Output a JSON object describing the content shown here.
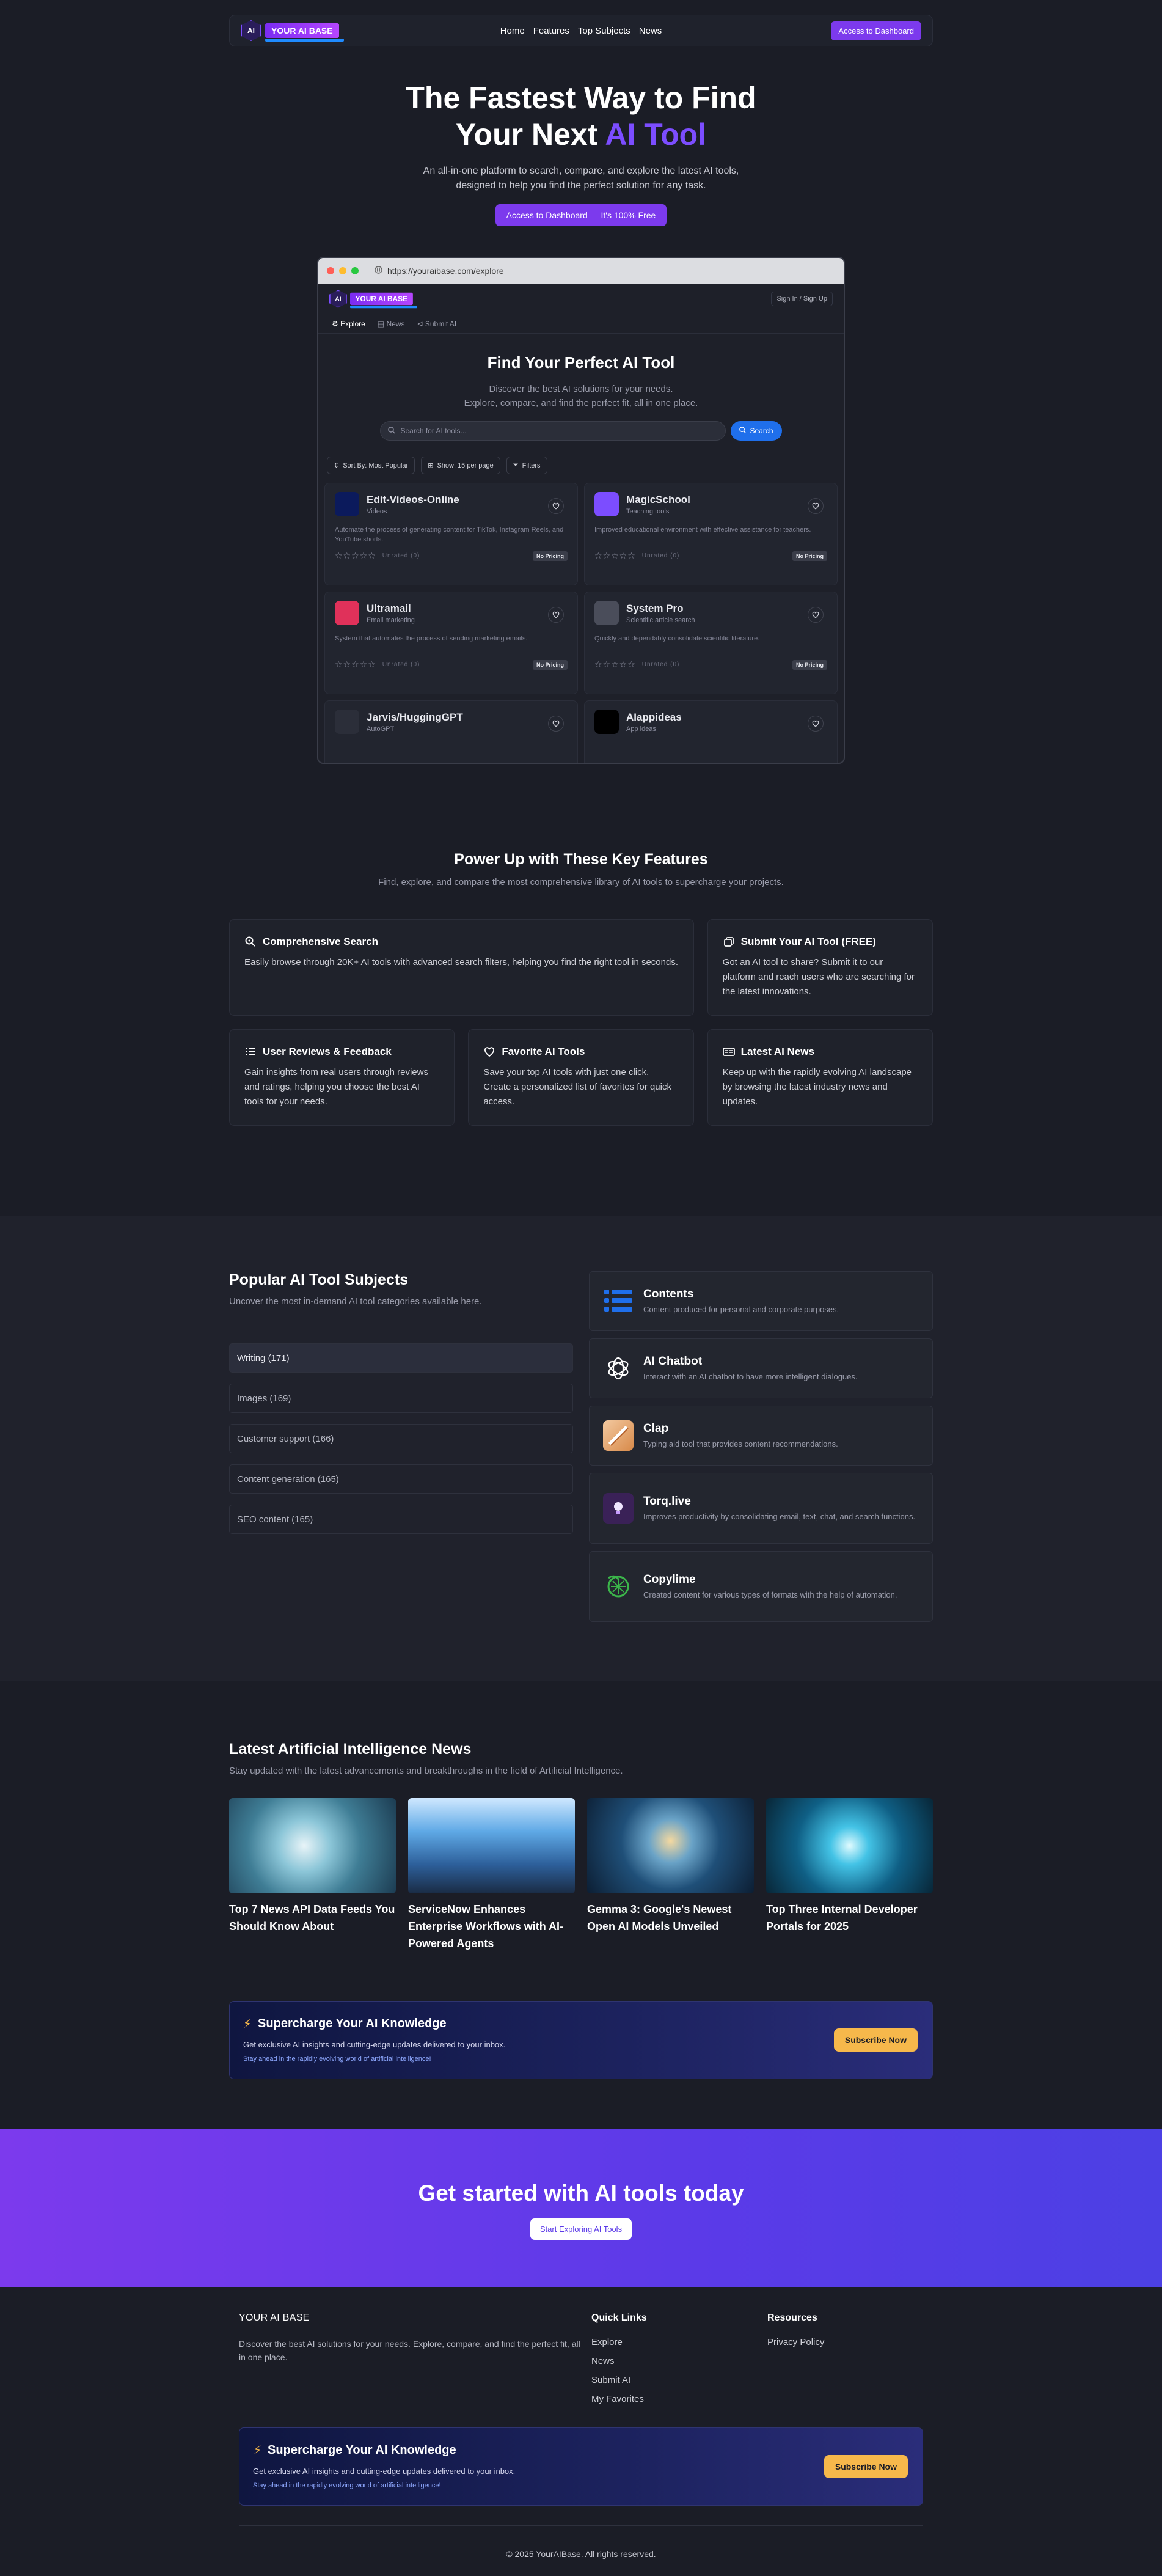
{
  "nav": {
    "logo_mark": "AI",
    "logo_text": "YOUR AI BASE",
    "links": [
      "Home",
      "Features",
      "Top Subjects",
      "News"
    ],
    "cta": "Access to Dashboard"
  },
  "hero": {
    "title_line1": "The Fastest Way to Find",
    "title_line2_prefix": "Your Next ",
    "title_line2_accent": "AI Tool",
    "subtitle_line1": "An all-in-one platform to search, compare, and explore the latest AI tools,",
    "subtitle_line2": "designed to help you find the perfect solution for any task.",
    "cta": "Access to Dashboard — It's 100% Free"
  },
  "browser": {
    "url": "https://youraibase.com/explore",
    "signin": "Sign In / Sign Up",
    "tabs": [
      "Explore",
      "News",
      "Submit AI"
    ],
    "title": "Find Your Perfect AI Tool",
    "subtitle_line1": "Discover the best AI solutions for your needs.",
    "subtitle_line2": "Explore, compare, and find the perfect fit, all in one place.",
    "search_placeholder": "Search for AI tools...",
    "search_button": "Search",
    "filters": [
      "Sort By: Most Popular",
      "Show: 15 per page",
      "Filters"
    ],
    "tools": [
      {
        "name": "Edit-Videos-Online",
        "category": "Videos",
        "description": "Automate the process of generating content for TikTok, Instagram Reels, and YouTube shorts.",
        "rating": "Unrated (0)",
        "pricing": "No Pricing",
        "icon_color": "#0b1a5c"
      },
      {
        "name": "MagicSchool",
        "category": "Teaching tools",
        "description": "Improved educational environment with effective assistance for teachers.",
        "rating": "Unrated (0)",
        "pricing": "No Pricing",
        "icon_color": "#7c4dff"
      },
      {
        "name": "Ultramail",
        "category": "Email marketing",
        "description": "System that automates the process of sending marketing emails.",
        "rating": "Unrated (0)",
        "pricing": "No Pricing",
        "icon_color": "#e0315a"
      },
      {
        "name": "System Pro",
        "category": "Scientific article search",
        "description": "Quickly and dependably consolidate scientific literature.",
        "rating": "Unrated (0)",
        "pricing": "No Pricing",
        "icon_color": "#4a4d5a"
      },
      {
        "name": "Jarvis/HuggingGPT",
        "category": "AutoGPT",
        "description": "",
        "rating": "",
        "pricing": "",
        "icon_color": "#2b2e39"
      },
      {
        "name": "AIappideas",
        "category": "App ideas",
        "description": "",
        "rating": "",
        "pricing": "",
        "icon_color": "#000000"
      }
    ]
  },
  "features": {
    "title": "Power Up with These Key Features",
    "subtitle": "Find, explore, and compare the most comprehensive library of AI tools to supercharge your projects.",
    "items": [
      {
        "title": "Comprehensive Search",
        "text": "Easily browse through 20K+ AI tools with advanced search filters, helping you find the right tool in seconds.",
        "icon": "search-icon"
      },
      {
        "title": "Submit Your AI Tool (FREE)",
        "text": "Got an AI tool to share? Submit it to our platform and reach users who are searching for the latest innovations.",
        "icon": "copy-icon"
      },
      {
        "title": "User Reviews & Feedback",
        "text": "Gain insights from real users through reviews and ratings, helping you choose the best AI tools for your needs.",
        "icon": "list-icon"
      },
      {
        "title": "Favorite AI Tools",
        "text": "Save your top AI tools with just one click. Create a personalized list of favorites for quick access.",
        "icon": "heart-icon"
      },
      {
        "title": "Latest AI News",
        "text": "Keep up with the rapidly evolving AI landscape by browsing the latest industry news and updates.",
        "icon": "newspaper-icon"
      }
    ]
  },
  "popular": {
    "title": "Popular AI Tool Subjects",
    "subtitle": "Uncover the most in-demand AI tool categories available here.",
    "subjects": [
      "Writing (171)",
      "Images (169)",
      "Customer support (166)",
      "Content generation (165)",
      "SEO content (165)"
    ],
    "apps": [
      {
        "name": "Contents",
        "description": "Content produced for personal and corporate purposes."
      },
      {
        "name": "AI Chatbot",
        "description": "Interact with an AI chatbot to have more intelligent dialogues."
      },
      {
        "name": "Clap",
        "description": "Typing aid tool that provides content recommendations."
      },
      {
        "name": "Torq.live",
        "description": "Improves productivity by consolidating email, text, chat, and search functions."
      },
      {
        "name": "Copylime",
        "description": "Created content for various types of formats with the help of automation."
      }
    ]
  },
  "news": {
    "title": "Latest Artificial Intelligence News",
    "subtitle": "Stay updated with the latest advancements and breakthroughs in the field of Artificial Intelligence.",
    "articles": [
      {
        "title": "Top 7 News API Data Feeds You Should Know About"
      },
      {
        "title": "ServiceNow Enhances Enterprise Workflows with AI-Powered Agents"
      },
      {
        "title": "Gemma 3: Google's Newest Open AI Models Unveiled"
      },
      {
        "title": "Top Three Internal Developer Portals for 2025"
      }
    ]
  },
  "subscribe": {
    "title": "Supercharge Your AI Knowledge",
    "text": "Get exclusive AI insights and cutting-edge updates delivered to your inbox.",
    "note": "Stay ahead in the rapidly evolving world of artificial intelligence!",
    "button": "Subscribe Now"
  },
  "band": {
    "title": "Get started with AI tools today",
    "button": "Start Exploring AI Tools"
  },
  "footer": {
    "brand": "YOUR AI BASE",
    "description": "Discover the best AI solutions for your needs. Explore, compare, and find the perfect fit, all in one place.",
    "quick_links_title": "Quick Links",
    "quick_links": [
      "Explore",
      "News",
      "Submit AI",
      "My Favorites"
    ],
    "resources_title": "Resources",
    "resources": [
      "Privacy Policy"
    ],
    "copyright": "© 2025 YourAIBase. All rights reserved."
  },
  "colors": {
    "background": "#1b1d26",
    "accent": "#7c3aed",
    "accent_text": "#7c4dff",
    "subscribe_button": "#f6b84b",
    "search_button": "#1f6feb"
  }
}
